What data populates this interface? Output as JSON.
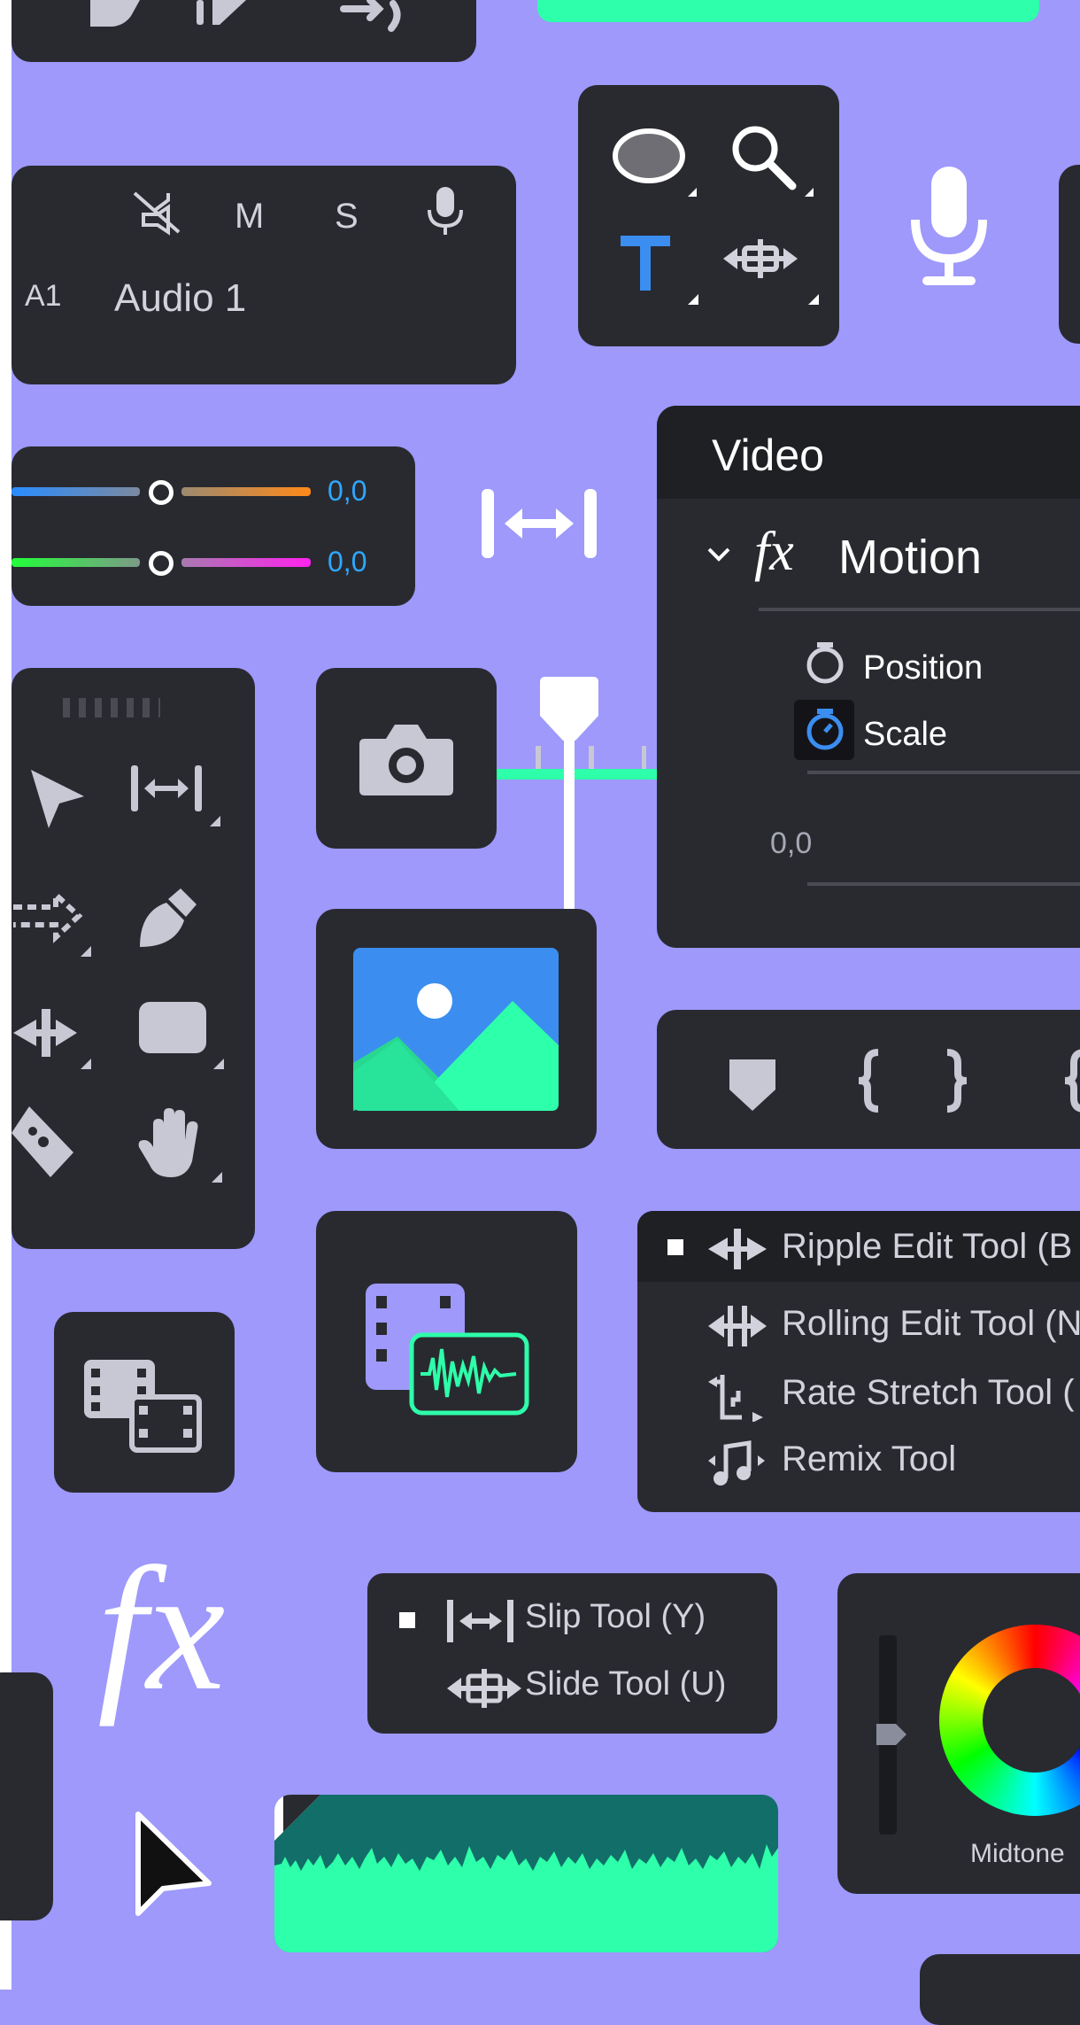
{
  "audio_track": {
    "id_label": "A1",
    "name": "Audio 1",
    "toggles": {
      "mute": "M",
      "solo": "S"
    }
  },
  "color_sliders": {
    "value_1": "0,0",
    "value_2": "0,0",
    "accent": "#2ea8ff"
  },
  "effect_controls": {
    "panel_title": "Video",
    "fx_glyph": "fx",
    "effect_name": "Motion",
    "params": [
      {
        "label": "Position",
        "keyframing": false
      },
      {
        "label": "Scale",
        "keyframing": true
      }
    ],
    "value": "0,0"
  },
  "edit_tools_menu": {
    "items": [
      {
        "label": "Ripple Edit Tool (B",
        "selected": true
      },
      {
        "label": "Rolling Edit Tool (N",
        "selected": false
      },
      {
        "label": "Rate Stretch Tool (",
        "selected": false
      },
      {
        "label": "Remix Tool",
        "selected": false
      }
    ]
  },
  "slip_menu": {
    "items": [
      {
        "label": "Slip Tool (Y)",
        "selected": true
      },
      {
        "label": "Slide Tool (U)",
        "selected": false
      }
    ]
  },
  "fx_badge": "fx",
  "color_wheel": {
    "label": "Midtone"
  },
  "colors": {
    "background": "#9e99fb",
    "panel": "#292a30",
    "accent_green": "#2effaa",
    "accent_blue": "#3b8ef0",
    "icon_gray": "#c8c8d4"
  },
  "icons": [
    "play-icon",
    "step-icon",
    "transfer-icon",
    "audio-off-icon",
    "microphone-icon",
    "ellipse-tool-icon",
    "zoom-tool-icon",
    "type-tool-icon",
    "slide-tool-icon",
    "fit-width-icon",
    "selection-tool-icon",
    "track-select-icon",
    "pen-tool-icon",
    "ripple-edit-icon",
    "rectangle-tool-icon",
    "razor-tool-icon",
    "hand-tool-icon",
    "camera-icon",
    "image-icon",
    "nested-sequence-icon",
    "multicam-audio-icon",
    "marker-icon",
    "in-point-icon",
    "out-point-icon",
    "cursor-icon",
    "stopwatch-icon"
  ]
}
